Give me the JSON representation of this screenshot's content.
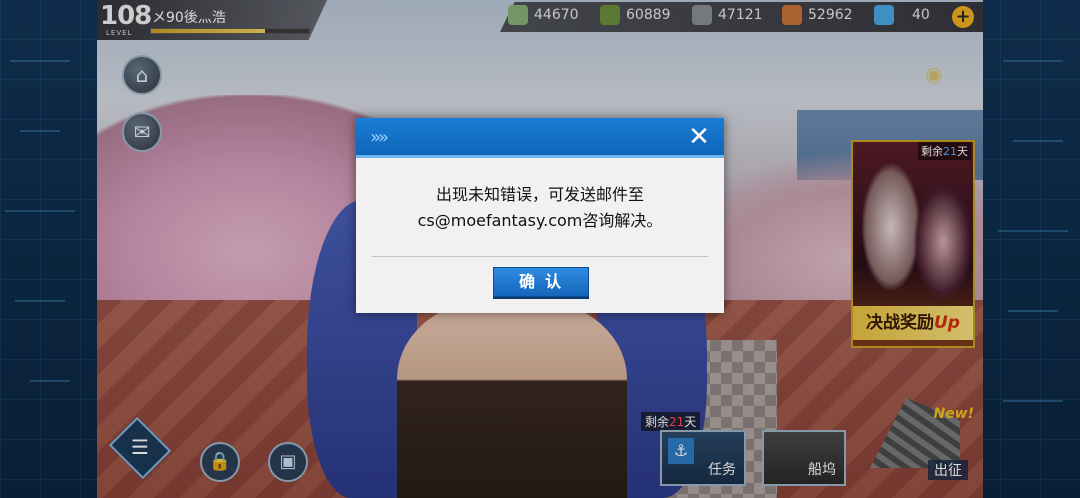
{
  "player": {
    "level": "108",
    "level_caption": "LEVEL",
    "name": "メ90後灬浩",
    "xp_fraction": 0.72
  },
  "resources": [
    {
      "icon": "fuel-icon",
      "value": "44670",
      "color": "#8bb07a"
    },
    {
      "icon": "ammo-icon",
      "value": "60889",
      "color": "#6d8f3e"
    },
    {
      "icon": "steel-icon",
      "value": "47121",
      "color": "#8a8f96"
    },
    {
      "icon": "aluminum-icon",
      "value": "52962",
      "color": "#c8743a"
    },
    {
      "icon": "diamond-icon",
      "value": "40",
      "color": "#4aa8e8"
    }
  ],
  "plus_label": "+",
  "left_buttons": {
    "home_icon": "⌂",
    "mail_icon": "✉"
  },
  "event_banner": {
    "days_prefix": "剩余",
    "days_num": "21",
    "days_suffix": "天",
    "title": "决战奖励",
    "title_up": "Up"
  },
  "bottom": {
    "menu_icon": "☰",
    "shop_icon": "🔒",
    "gift_icon": "▣",
    "mission_days_prefix": "剩余",
    "mission_days_num": "21",
    "mission_days_suffix": "天",
    "mission_label": "任务",
    "dock_label": "船坞",
    "sortie_label": "出征",
    "new_badge": "New!"
  },
  "dialog": {
    "message": "出现未知错误，可发送邮件至cs@moefantasy.com咨询解决。",
    "confirm_label": "确认",
    "close_glyph": "✕",
    "header_glyph": "»»"
  },
  "colors": {
    "dialog_header": "#1a7ed6",
    "confirm_button": "#2f8be0",
    "accent_gold": "#f0b020"
  }
}
